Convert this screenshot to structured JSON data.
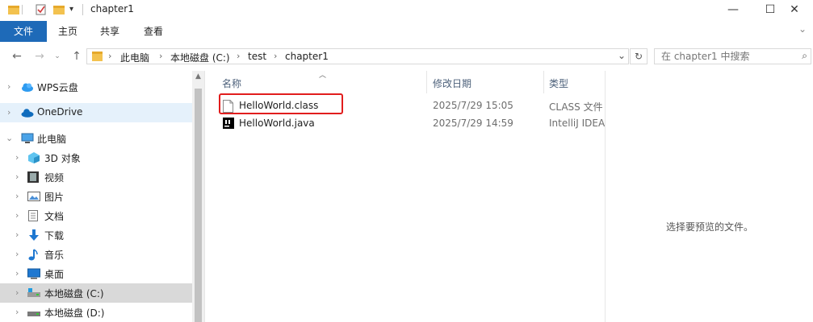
{
  "window": {
    "title": "chapter1",
    "minimize": "—",
    "maximize": "☐",
    "close": "✕"
  },
  "ribbon": {
    "tabs": [
      "文件",
      "主页",
      "共享",
      "查看"
    ],
    "help": "⌄"
  },
  "address": {
    "breadcrumbs": [
      "此电脑",
      "本地磁盘 (C:)",
      "test",
      "chapter1"
    ],
    "dropdown": "⌄",
    "refresh": "↻"
  },
  "search": {
    "placeholder": "在 chapter1 中搜索"
  },
  "nav": {
    "items": [
      {
        "label": "WPS云盘",
        "icon": "cloud-blue-icon"
      },
      {
        "label": "OneDrive",
        "icon": "onedrive-icon"
      },
      {
        "label": "此电脑",
        "icon": "computer-icon"
      },
      {
        "label": "3D 对象",
        "icon": "3d-objects-icon"
      },
      {
        "label": "视频",
        "icon": "video-icon"
      },
      {
        "label": "图片",
        "icon": "pictures-icon"
      },
      {
        "label": "文档",
        "icon": "documents-icon"
      },
      {
        "label": "下载",
        "icon": "download-icon"
      },
      {
        "label": "音乐",
        "icon": "music-icon"
      },
      {
        "label": "桌面",
        "icon": "desktop-icon"
      },
      {
        "label": "本地磁盘 (C:)",
        "icon": "drive-c-icon"
      },
      {
        "label": "本地磁盘 (D:)",
        "icon": "drive-d-icon"
      }
    ]
  },
  "columns": {
    "name": "名称",
    "date": "修改日期",
    "type": "类型"
  },
  "files": [
    {
      "name": "HelloWorld.class",
      "date": "2025/7/29 15:05",
      "type": "CLASS 文件",
      "icon": "blank-file-icon"
    },
    {
      "name": "HelloWorld.java",
      "date": "2025/7/29 14:59",
      "type": "IntelliJ IDEA",
      "icon": "intellij-file-icon"
    }
  ],
  "preview": {
    "message": "选择要预览的文件。"
  },
  "colors": {
    "ribbon_file_tab": "#1e6ab8",
    "selection_light": "#e5f1fb",
    "selection_gray": "#d9d9d9",
    "highlight_box": "#e11d1d"
  }
}
